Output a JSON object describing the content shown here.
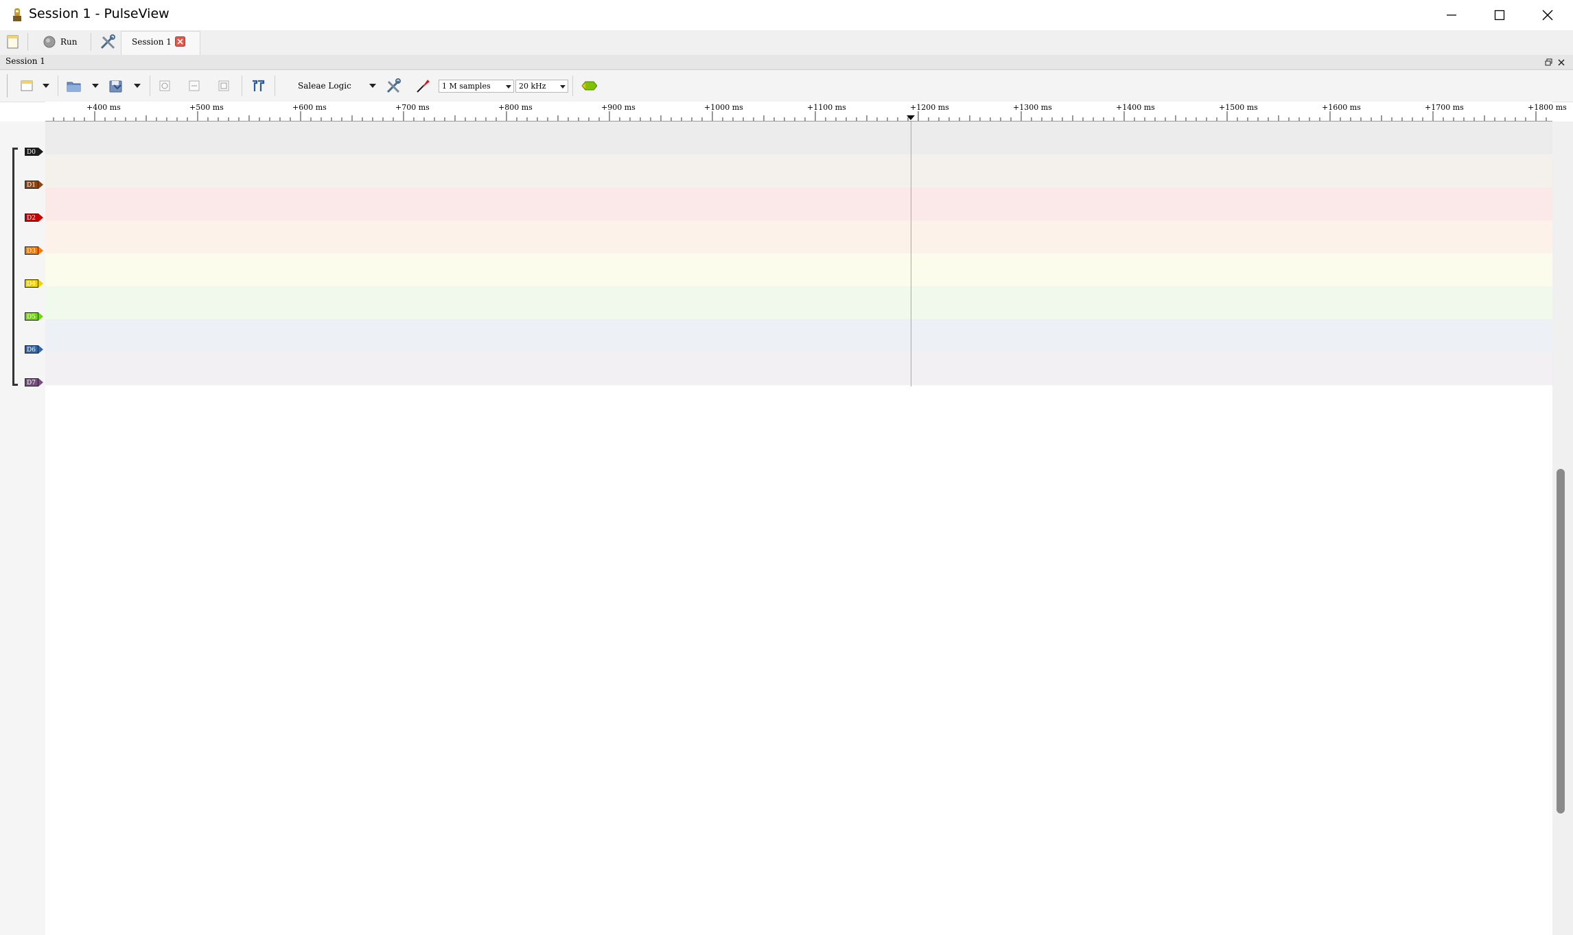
{
  "window": {
    "title": "Session 1 - PulseView"
  },
  "main_toolbar": {
    "run_label": "Run",
    "session_tab_label": "Session 1"
  },
  "session_dock": {
    "title": "Session 1"
  },
  "session_toolbar": {
    "device_name": "Saleae Logic",
    "samples_value": "1 M samples",
    "samplerate_value": "20 kHz"
  },
  "ruler": {
    "tick_labels": [
      "+400 ms",
      "+500 ms",
      "+600 ms",
      "+700 ms",
      "+800 ms",
      "+900 ms",
      "+1000 ms",
      "+1100 ms",
      "+1200 ms",
      "+1300 ms",
      "+1400 ms",
      "+1500 ms",
      "+1600 ms",
      "+1700 ms",
      "+1800 ms"
    ]
  },
  "channels": [
    {
      "name": "D0",
      "color": "#1a1a1a",
      "bg": "#ececec"
    },
    {
      "name": "D1",
      "color": "#8b4513",
      "bg": "#f4f1ec"
    },
    {
      "name": "D2",
      "color": "#cc0000",
      "bg": "#fbe9e9"
    },
    {
      "name": "D3",
      "color": "#f57900",
      "bg": "#fdf2e9"
    },
    {
      "name": "D4",
      "color": "#edd400",
      "bg": "#fcfcec"
    },
    {
      "name": "D5",
      "color": "#73d216",
      "bg": "#f1f8ec"
    },
    {
      "name": "D6",
      "color": "#3465a4",
      "bg": "#edf1f6"
    },
    {
      "name": "D7",
      "color": "#75507b",
      "bg": "#f2f0f3"
    }
  ],
  "icons": [
    "pulseview-icon",
    "minimize-icon",
    "maximize-icon",
    "close-icon",
    "new-session-icon",
    "run-icon",
    "settings-icon",
    "tab-close-icon",
    "restore-icon",
    "open-icon",
    "save-icon",
    "zoom-in-icon",
    "zoom-out-icon",
    "zoom-fit-icon",
    "cursor-icon",
    "device-config-icon",
    "probe-icon",
    "decoder-icon"
  ]
}
